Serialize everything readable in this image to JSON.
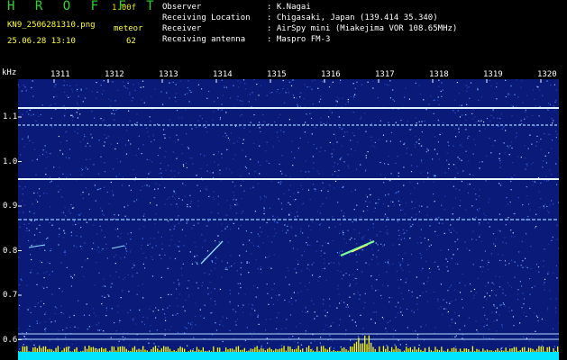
{
  "header": {
    "brand": "H R O F F T",
    "version": "1.00f",
    "filename": "KN9_2506281310.png",
    "meteor_label": "meteor",
    "timestamp": "25.06.28 13:10",
    "meteor_count": "62",
    "info": [
      {
        "key": "Observer",
        "value": ": K.Nagai"
      },
      {
        "key": "Receiving Location",
        "value": ": Chigasaki, Japan (139.414 35.340)"
      },
      {
        "key": "Receiver",
        "value": ": AirSpy mini (Miakejima VOR 108.65MHz)"
      },
      {
        "key": "Receiving antenna",
        "value": ": Maspro FM-3"
      }
    ]
  },
  "axes": {
    "y_unit": "kHz",
    "x_ticks": [
      "1311",
      "1312",
      "1313",
      "1314",
      "1315",
      "1316",
      "1317",
      "1318",
      "1319",
      "1320"
    ],
    "y_ticks": [
      "1.1",
      "1.0",
      "0.9",
      "0.8",
      "0.7",
      "0.6"
    ]
  },
  "colors": {
    "background": "#0a1a78",
    "tone": "#cfe8ff",
    "meteor": "#7dff9a",
    "echo_bars": "#ffff00",
    "baseline": "#00e5ff"
  }
}
